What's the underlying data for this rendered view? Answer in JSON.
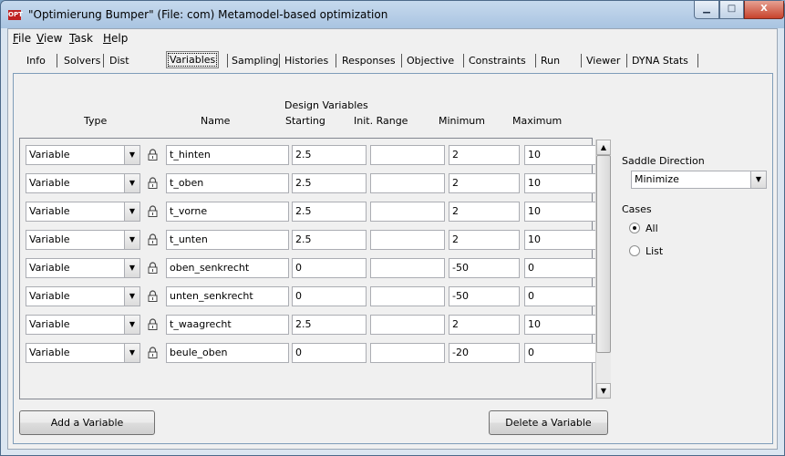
{
  "window": {
    "app_icon": "OPT",
    "title": "\"Optimierung Bumper\" (File: com)   Metamodel-based optimization",
    "min_icon": "▁",
    "max_icon": "□",
    "close_icon": "X"
  },
  "menu": [
    {
      "label": "File",
      "key": "F",
      "rest": "ile"
    },
    {
      "label": "View",
      "key": "V",
      "rest": "iew"
    },
    {
      "label": "Task",
      "key": "T",
      "rest": "ask"
    },
    {
      "label": "Help",
      "key": "H",
      "rest": "elp"
    }
  ],
  "tabs": [
    {
      "label": "Info"
    },
    {
      "label": "Solvers"
    },
    {
      "label": "Dist"
    },
    {
      "label": "Variables",
      "active": true
    },
    {
      "label": "Sampling"
    },
    {
      "label": "Histories"
    },
    {
      "label": "Responses"
    },
    {
      "label": "Objective"
    },
    {
      "label": "Constraints"
    },
    {
      "label": "Run"
    },
    {
      "label": "Viewer"
    },
    {
      "label": "DYNA Stats"
    }
  ],
  "variables_panel": {
    "group_title": "Design Variables",
    "columns": {
      "type": "Type",
      "name": "Name",
      "starting": "Starting",
      "init_range": "Init. Range",
      "minimum": "Minimum",
      "maximum": "Maximum"
    },
    "rows": [
      {
        "type": "Variable",
        "name": "t_hinten",
        "starting": "2.5",
        "init_range": "",
        "minimum": "2",
        "maximum": "10"
      },
      {
        "type": "Variable",
        "name": "t_oben",
        "starting": "2.5",
        "init_range": "",
        "minimum": "2",
        "maximum": "10"
      },
      {
        "type": "Variable",
        "name": "t_vorne",
        "starting": "2.5",
        "init_range": "",
        "minimum": "2",
        "maximum": "10"
      },
      {
        "type": "Variable",
        "name": "t_unten",
        "starting": "2.5",
        "init_range": "",
        "minimum": "2",
        "maximum": "10"
      },
      {
        "type": "Variable",
        "name": "oben_senkrecht",
        "starting": "0",
        "init_range": "",
        "minimum": "-50",
        "maximum": "0"
      },
      {
        "type": "Variable",
        "name": "unten_senkrecht",
        "starting": "0",
        "init_range": "",
        "minimum": "-50",
        "maximum": "0"
      },
      {
        "type": "Variable",
        "name": "t_waagrecht",
        "starting": "2.5",
        "init_range": "",
        "minimum": "2",
        "maximum": "10"
      },
      {
        "type": "Variable",
        "name": "beule_oben",
        "starting": "0",
        "init_range": "",
        "minimum": "-20",
        "maximum": "0"
      }
    ],
    "add_button": "Add a Variable",
    "delete_button": "Delete a Variable",
    "combo_arrow": "▼",
    "scroll_up": "▲",
    "scroll_down": "▼"
  },
  "side": {
    "saddle_label": "Saddle Direction",
    "saddle_value": "Minimize",
    "cases_label": "Cases",
    "case_options": [
      {
        "label": "All",
        "selected": true
      },
      {
        "label": "List",
        "selected": false
      }
    ]
  }
}
